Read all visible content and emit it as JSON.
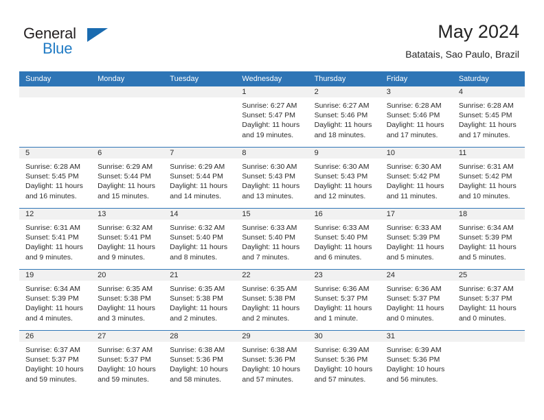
{
  "brand": {
    "name_dark": "General",
    "name_blue": "Blue",
    "triangle_icon": "blue-triangle-logo-mark",
    "accent_color": "#1f7ac4"
  },
  "header": {
    "title": "May 2024",
    "subtitle": "Batatais, Sao Paulo, Brazil"
  },
  "theme": {
    "header_bg": "#2e75b6",
    "header_text": "#ffffff",
    "daynum_bg": "#f1f1f1",
    "cell_bg": "#ffffff",
    "row_divider": "#2e75b6",
    "body_text": "#2a2a2a"
  },
  "weekday_headers": [
    "Sunday",
    "Monday",
    "Tuesday",
    "Wednesday",
    "Thursday",
    "Friday",
    "Saturday"
  ],
  "weeks": [
    [
      {
        "day": "",
        "empty": true,
        "line1": "",
        "line2": "",
        "line3": "",
        "line4": ""
      },
      {
        "day": "",
        "empty": true,
        "line1": "",
        "line2": "",
        "line3": "",
        "line4": ""
      },
      {
        "day": "",
        "empty": true,
        "line1": "",
        "line2": "",
        "line3": "",
        "line4": ""
      },
      {
        "day": "1",
        "empty": false,
        "line1": "Sunrise: 6:27 AM",
        "line2": "Sunset: 5:47 PM",
        "line3": "Daylight: 11 hours",
        "line4": "and 19 minutes."
      },
      {
        "day": "2",
        "empty": false,
        "line1": "Sunrise: 6:27 AM",
        "line2": "Sunset: 5:46 PM",
        "line3": "Daylight: 11 hours",
        "line4": "and 18 minutes."
      },
      {
        "day": "3",
        "empty": false,
        "line1": "Sunrise: 6:28 AM",
        "line2": "Sunset: 5:46 PM",
        "line3": "Daylight: 11 hours",
        "line4": "and 17 minutes."
      },
      {
        "day": "4",
        "empty": false,
        "line1": "Sunrise: 6:28 AM",
        "line2": "Sunset: 5:45 PM",
        "line3": "Daylight: 11 hours",
        "line4": "and 17 minutes."
      }
    ],
    [
      {
        "day": "5",
        "empty": false,
        "line1": "Sunrise: 6:28 AM",
        "line2": "Sunset: 5:45 PM",
        "line3": "Daylight: 11 hours",
        "line4": "and 16 minutes."
      },
      {
        "day": "6",
        "empty": false,
        "line1": "Sunrise: 6:29 AM",
        "line2": "Sunset: 5:44 PM",
        "line3": "Daylight: 11 hours",
        "line4": "and 15 minutes."
      },
      {
        "day": "7",
        "empty": false,
        "line1": "Sunrise: 6:29 AM",
        "line2": "Sunset: 5:44 PM",
        "line3": "Daylight: 11 hours",
        "line4": "and 14 minutes."
      },
      {
        "day": "8",
        "empty": false,
        "line1": "Sunrise: 6:30 AM",
        "line2": "Sunset: 5:43 PM",
        "line3": "Daylight: 11 hours",
        "line4": "and 13 minutes."
      },
      {
        "day": "9",
        "empty": false,
        "line1": "Sunrise: 6:30 AM",
        "line2": "Sunset: 5:43 PM",
        "line3": "Daylight: 11 hours",
        "line4": "and 12 minutes."
      },
      {
        "day": "10",
        "empty": false,
        "line1": "Sunrise: 6:30 AM",
        "line2": "Sunset: 5:42 PM",
        "line3": "Daylight: 11 hours",
        "line4": "and 11 minutes."
      },
      {
        "day": "11",
        "empty": false,
        "line1": "Sunrise: 6:31 AM",
        "line2": "Sunset: 5:42 PM",
        "line3": "Daylight: 11 hours",
        "line4": "and 10 minutes."
      }
    ],
    [
      {
        "day": "12",
        "empty": false,
        "line1": "Sunrise: 6:31 AM",
        "line2": "Sunset: 5:41 PM",
        "line3": "Daylight: 11 hours",
        "line4": "and 9 minutes."
      },
      {
        "day": "13",
        "empty": false,
        "line1": "Sunrise: 6:32 AM",
        "line2": "Sunset: 5:41 PM",
        "line3": "Daylight: 11 hours",
        "line4": "and 9 minutes."
      },
      {
        "day": "14",
        "empty": false,
        "line1": "Sunrise: 6:32 AM",
        "line2": "Sunset: 5:40 PM",
        "line3": "Daylight: 11 hours",
        "line4": "and 8 minutes."
      },
      {
        "day": "15",
        "empty": false,
        "line1": "Sunrise: 6:33 AM",
        "line2": "Sunset: 5:40 PM",
        "line3": "Daylight: 11 hours",
        "line4": "and 7 minutes."
      },
      {
        "day": "16",
        "empty": false,
        "line1": "Sunrise: 6:33 AM",
        "line2": "Sunset: 5:40 PM",
        "line3": "Daylight: 11 hours",
        "line4": "and 6 minutes."
      },
      {
        "day": "17",
        "empty": false,
        "line1": "Sunrise: 6:33 AM",
        "line2": "Sunset: 5:39 PM",
        "line3": "Daylight: 11 hours",
        "line4": "and 5 minutes."
      },
      {
        "day": "18",
        "empty": false,
        "line1": "Sunrise: 6:34 AM",
        "line2": "Sunset: 5:39 PM",
        "line3": "Daylight: 11 hours",
        "line4": "and 5 minutes."
      }
    ],
    [
      {
        "day": "19",
        "empty": false,
        "line1": "Sunrise: 6:34 AM",
        "line2": "Sunset: 5:39 PM",
        "line3": "Daylight: 11 hours",
        "line4": "and 4 minutes."
      },
      {
        "day": "20",
        "empty": false,
        "line1": "Sunrise: 6:35 AM",
        "line2": "Sunset: 5:38 PM",
        "line3": "Daylight: 11 hours",
        "line4": "and 3 minutes."
      },
      {
        "day": "21",
        "empty": false,
        "line1": "Sunrise: 6:35 AM",
        "line2": "Sunset: 5:38 PM",
        "line3": "Daylight: 11 hours",
        "line4": "and 2 minutes."
      },
      {
        "day": "22",
        "empty": false,
        "line1": "Sunrise: 6:35 AM",
        "line2": "Sunset: 5:38 PM",
        "line3": "Daylight: 11 hours",
        "line4": "and 2 minutes."
      },
      {
        "day": "23",
        "empty": false,
        "line1": "Sunrise: 6:36 AM",
        "line2": "Sunset: 5:37 PM",
        "line3": "Daylight: 11 hours",
        "line4": "and 1 minute."
      },
      {
        "day": "24",
        "empty": false,
        "line1": "Sunrise: 6:36 AM",
        "line2": "Sunset: 5:37 PM",
        "line3": "Daylight: 11 hours",
        "line4": "and 0 minutes."
      },
      {
        "day": "25",
        "empty": false,
        "line1": "Sunrise: 6:37 AM",
        "line2": "Sunset: 5:37 PM",
        "line3": "Daylight: 11 hours",
        "line4": "and 0 minutes."
      }
    ],
    [
      {
        "day": "26",
        "empty": false,
        "line1": "Sunrise: 6:37 AM",
        "line2": "Sunset: 5:37 PM",
        "line3": "Daylight: 10 hours",
        "line4": "and 59 minutes."
      },
      {
        "day": "27",
        "empty": false,
        "line1": "Sunrise: 6:37 AM",
        "line2": "Sunset: 5:37 PM",
        "line3": "Daylight: 10 hours",
        "line4": "and 59 minutes."
      },
      {
        "day": "28",
        "empty": false,
        "line1": "Sunrise: 6:38 AM",
        "line2": "Sunset: 5:36 PM",
        "line3": "Daylight: 10 hours",
        "line4": "and 58 minutes."
      },
      {
        "day": "29",
        "empty": false,
        "line1": "Sunrise: 6:38 AM",
        "line2": "Sunset: 5:36 PM",
        "line3": "Daylight: 10 hours",
        "line4": "and 57 minutes."
      },
      {
        "day": "30",
        "empty": false,
        "line1": "Sunrise: 6:39 AM",
        "line2": "Sunset: 5:36 PM",
        "line3": "Daylight: 10 hours",
        "line4": "and 57 minutes."
      },
      {
        "day": "31",
        "empty": false,
        "line1": "Sunrise: 6:39 AM",
        "line2": "Sunset: 5:36 PM",
        "line3": "Daylight: 10 hours",
        "line4": "and 56 minutes."
      },
      {
        "day": "",
        "empty": true,
        "line1": "",
        "line2": "",
        "line3": "",
        "line4": ""
      }
    ]
  ]
}
